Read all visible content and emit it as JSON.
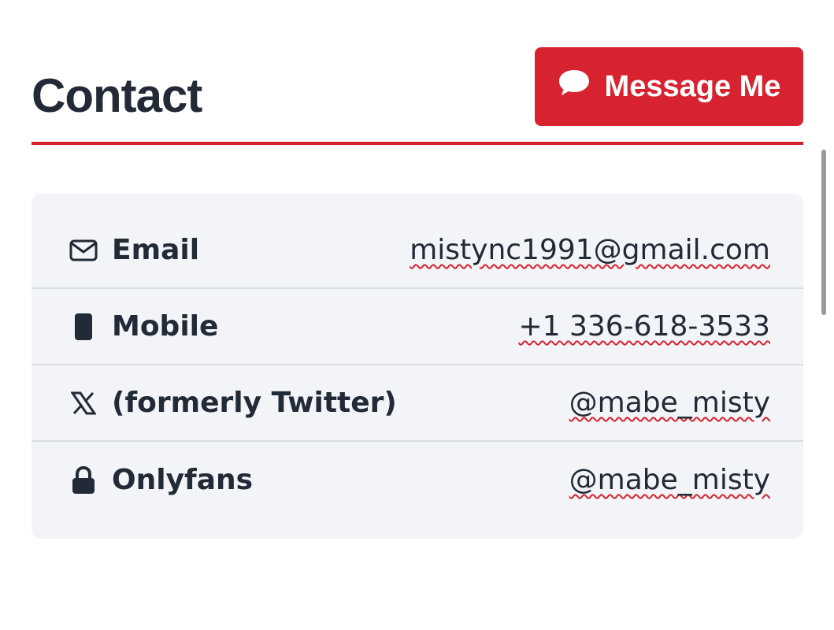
{
  "header": {
    "title": "Contact",
    "message_button": {
      "label": "Message Me",
      "icon": "chat-bubble-icon"
    }
  },
  "contacts": [
    {
      "icon": "envelope-icon",
      "label": "Email",
      "value": "mistync1991@gmail.com"
    },
    {
      "icon": "mobile-phone-icon",
      "label": "Mobile",
      "value": "+1 336-618-3533"
    },
    {
      "icon": "x-logo-icon",
      "label": "(formerly Twitter)",
      "value": "@mabe_misty"
    },
    {
      "icon": "lock-icon",
      "label": "Onlyfans",
      "value": "@mabe_misty"
    }
  ],
  "colors": {
    "accent": "#d7232f",
    "text": "#212a36",
    "card_background": "#f2f4f7"
  }
}
